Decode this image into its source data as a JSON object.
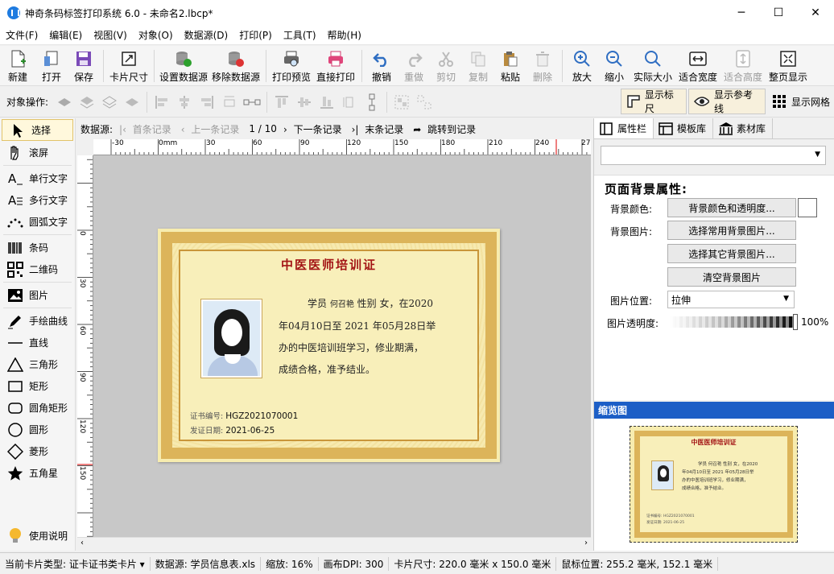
{
  "window": {
    "title": "神奇条码标签打印系统 6.0 - 未命名2.lbcp*",
    "minimize": "─",
    "maximize": "☐",
    "close": "✕"
  },
  "menu": [
    "文件(F)",
    "编辑(E)",
    "视图(V)",
    "对象(O)",
    "数据源(D)",
    "打印(P)",
    "工具(T)",
    "帮助(H)"
  ],
  "toolbar": {
    "new": "新建",
    "open": "打开",
    "save": "保存",
    "card_size": "卡片尺寸",
    "set_datasource": "设置数据源",
    "remove_datasource": "移除数据源",
    "print_preview": "打印预览",
    "direct_print": "直接打印",
    "undo": "撤销",
    "redo": "重做",
    "cut": "剪切",
    "copy": "复制",
    "paste": "粘贴",
    "delete": "删除",
    "zoom_in": "放大",
    "zoom_out": "缩小",
    "actual_size": "实际大小",
    "fit_width": "适合宽度",
    "fit_height": "适合高度",
    "full_page": "整页显示"
  },
  "objbar": {
    "label": "对象操作:",
    "show_ruler": "显示标尺",
    "show_guides": "显示参考线",
    "show_grid": "显示网格"
  },
  "tools": {
    "select": "选择",
    "scroll": "滚屏",
    "single_text": "单行文字",
    "multi_text": "多行文字",
    "arc_text": "圆弧文字",
    "barcode": "条码",
    "qrcode": "二维码",
    "image": "图片",
    "freehand": "手绘曲线",
    "line": "直线",
    "triangle": "三角形",
    "rect": "矩形",
    "round_rect": "圆角矩形",
    "circle": "圆形",
    "diamond": "菱形",
    "star": "五角星",
    "help": "使用说明"
  },
  "nav": {
    "label": "数据源:",
    "first": "首条记录",
    "prev": "上一条记录",
    "position": "1 / 10",
    "next": "下一条记录",
    "last": "末条记录",
    "jump": "跳转到记录"
  },
  "ruler": {
    "h": [
      "-30",
      "0mm",
      "30",
      "60",
      "90",
      "120",
      "150",
      "180",
      "210",
      "240",
      "270"
    ],
    "v": [
      "0",
      "30",
      "60",
      "90",
      "120",
      "150"
    ]
  },
  "card": {
    "title": "中医医师培训证",
    "line1_pre": "学员",
    "name": "何召艳",
    "line1_mid": "性别",
    "gender": "女",
    "line1_post": "，在2020",
    "line2": "年04月10日至  2021  年05月28日举",
    "line3": "办的中医培训班学习，修业期满，",
    "line4": "成绩合格，准予结业。",
    "cert_no_label": "证书编号:",
    "cert_no": "HGZ2021070001",
    "issue_label": "发证日期:",
    "issue_date": "2021-06-25"
  },
  "right": {
    "tab_props": "属性栏",
    "tab_templates": "模板库",
    "tab_assets": "素材库",
    "heading": "页面背景属性:",
    "bg_color_label": "背景颜色:",
    "bg_color_btn": "背景颜色和透明度...",
    "bg_img_label": "背景图片:",
    "bg_common_btn": "选择常用背景图片...",
    "bg_other_btn": "选择其它背景图片...",
    "bg_clear_btn": "清空背景图片",
    "pos_label": "图片位置:",
    "pos_value": "拉伸",
    "opacity_label": "图片透明度:",
    "opacity_value": "100%",
    "preview_title": "缩览图"
  },
  "status": {
    "card_type": "当前卡片类型: 证卡证书类卡片 ▾",
    "datasource": "数据源: 学员信息表.xls",
    "zoom": "缩放: 16%",
    "dpi": "画布DPI: 300",
    "size": "卡片尺寸: 220.0 毫米 x 150.0 毫米",
    "mouse": "鼠标位置: 255.2 毫米, 152.1 毫米"
  },
  "colors": {
    "accent": "#1c5ec6",
    "title_red": "#a31515",
    "gold": "#dcb45a"
  }
}
